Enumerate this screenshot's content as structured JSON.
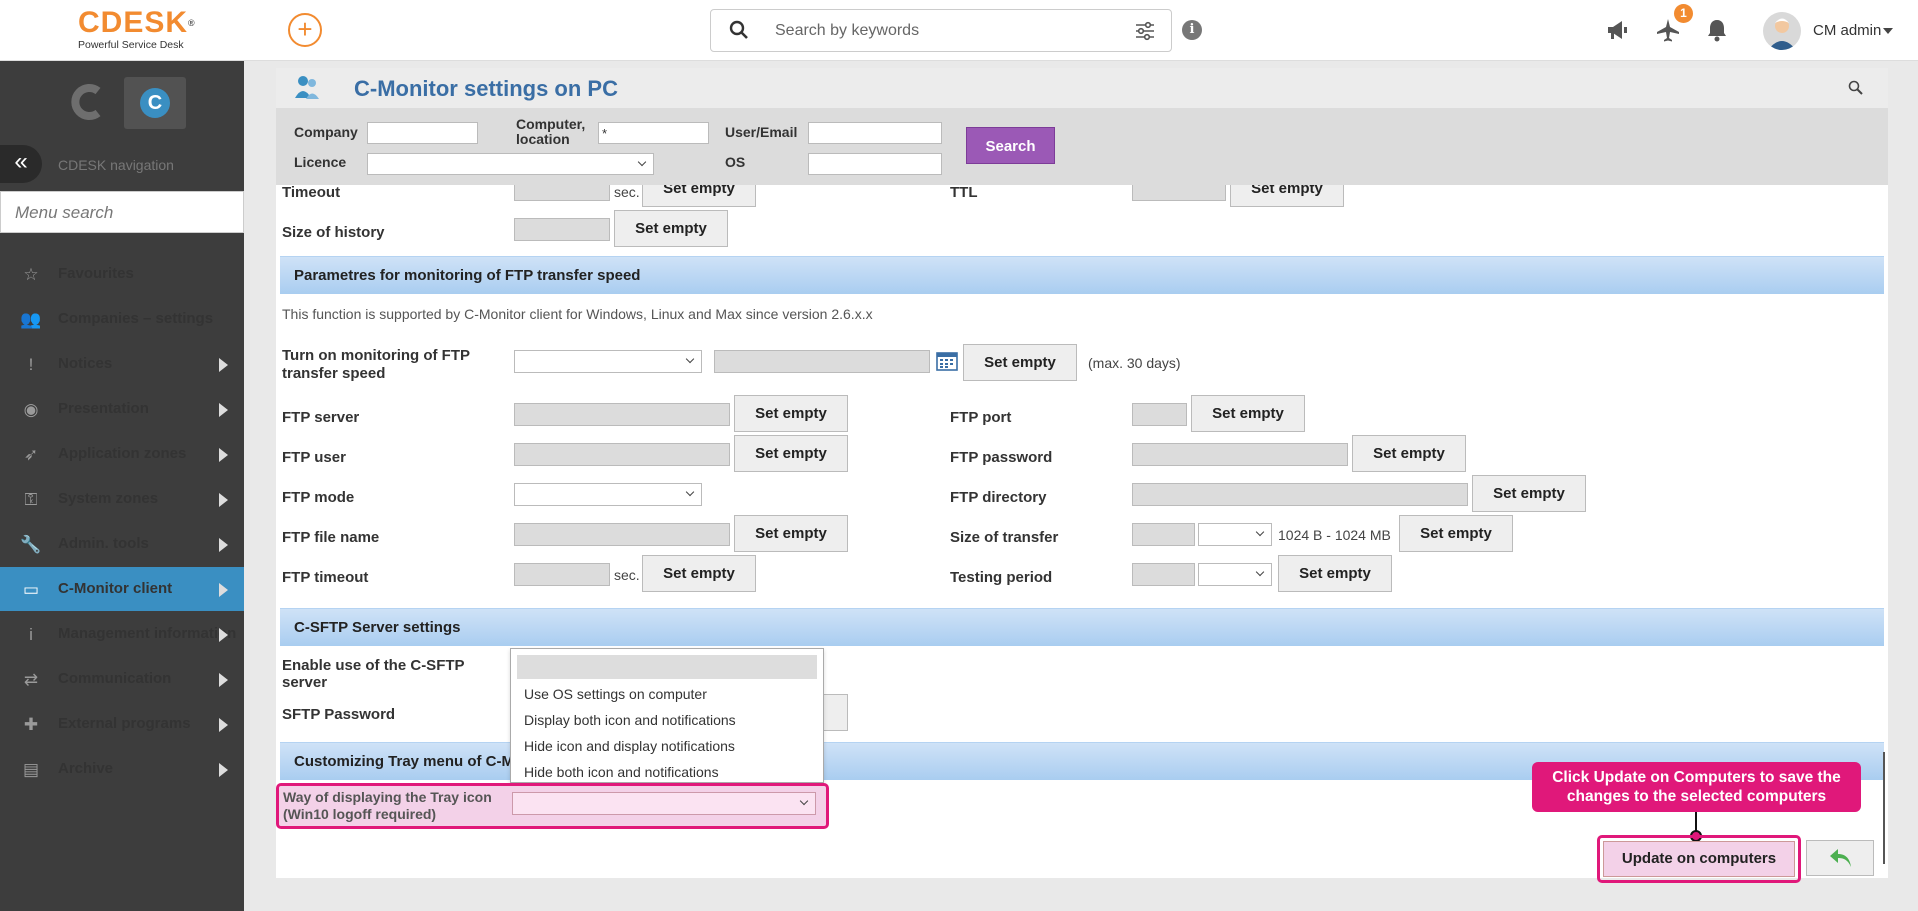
{
  "header": {
    "logo_text": "CDESK",
    "logo_reg": "®",
    "logo_sub": "Powerful Service Desk",
    "search_placeholder": "Search by keywords",
    "notification_count": "1",
    "user_name": "CM admin"
  },
  "sidebar": {
    "nav_label": "CDESK navigation",
    "menu_search_placeholder": "Menu search",
    "items": [
      {
        "label": "Favourites",
        "icon": "star-icon",
        "arrow": false
      },
      {
        "label": "Companies – settings",
        "icon": "users-icon",
        "arrow": false
      },
      {
        "label": "Notices",
        "icon": "exclamation-icon",
        "arrow": true
      },
      {
        "label": "Presentation",
        "icon": "eye-icon",
        "arrow": true
      },
      {
        "label": "Application zones",
        "icon": "rocket-icon",
        "arrow": true
      },
      {
        "label": "System zones",
        "icon": "key-icon",
        "arrow": true
      },
      {
        "label": "Admin. tools",
        "icon": "wrench-icon",
        "arrow": true
      },
      {
        "label": "C-Monitor client",
        "icon": "monitor-icon",
        "arrow": true,
        "active": true
      },
      {
        "label": "Management information",
        "icon": "info-icon",
        "arrow": true
      },
      {
        "label": "Communication",
        "icon": "exchange-icon",
        "arrow": true
      },
      {
        "label": "External programs",
        "icon": "puzzle-icon",
        "arrow": true
      },
      {
        "label": "Archive",
        "icon": "archive-icon",
        "arrow": true
      }
    ]
  },
  "page": {
    "title": "C-Monitor settings on PC"
  },
  "filter": {
    "company_label": "Company",
    "computer_label_1": "Computer,",
    "computer_label_2": "location",
    "computer_value": "*",
    "user_label": "User/Email",
    "licence_label": "Licence",
    "os_label": "OS",
    "search_button": "Search"
  },
  "content": {
    "timeout_label": "Timeout",
    "sec": "sec.",
    "set_empty": "Set empty",
    "ttl_label": "TTL",
    "history_label": "Size of history",
    "ftp_section": "Parametres for monitoring of FTP transfer speed",
    "ftp_note": "This function is supported by C-Monitor client for Windows, Linux and Max since version 2.6.x.x",
    "turn_on_label_1": "Turn on monitoring of FTP",
    "turn_on_label_2": "transfer speed",
    "max_days": "(max. 30 days)",
    "ftp_server": "FTP server",
    "ftp_port": "FTP port",
    "ftp_user": "FTP user",
    "ftp_password": "FTP password",
    "ftp_mode": "FTP mode",
    "ftp_directory": "FTP directory",
    "ftp_file_name": "FTP file name",
    "size_of_transfer": "Size of transfer",
    "size_range": "1024 B - 1024 MB",
    "ftp_timeout": "FTP timeout",
    "testing_period": "Testing period",
    "sftp_section": "C-SFTP Server settings",
    "enable_sftp_1": "Enable use of the C-SFTP",
    "enable_sftp_2": "server",
    "sftp_password": "SFTP Password",
    "tray_section": "Customizing Tray menu of C-M",
    "tray_label_1": "Way of displaying the  Tray icon",
    "tray_label_2": "(Win10 logoff required)"
  },
  "dropdown": {
    "options": [
      "Use OS settings on computer",
      "Display both icon and notifications",
      "Hide icon and display notifications",
      "Hide both icon and notifications"
    ]
  },
  "tooltip": {
    "line1": "Click Update on Computers to save the",
    "line2": "changes to the selected computers"
  },
  "actions": {
    "update_button": "Update on computers"
  },
  "colors": {
    "accent": "#3a8fc2",
    "highlight": "#e0187a",
    "search_button": "#9b59b6",
    "orange": "#f28b30"
  }
}
